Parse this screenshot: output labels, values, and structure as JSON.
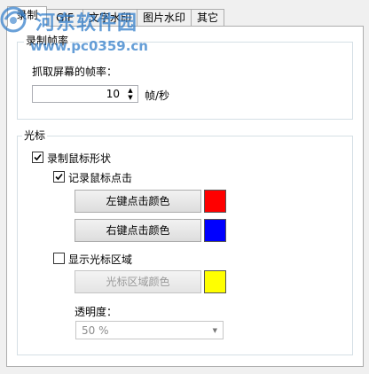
{
  "tabs": [
    {
      "label": "录制"
    },
    {
      "label": "GIF"
    },
    {
      "label": "文字水印"
    },
    {
      "label": "图片水印"
    },
    {
      "label": "其它"
    }
  ],
  "watermark": {
    "title": "河东软件园",
    "url": "www.pc0359.cn"
  },
  "recording_fps": {
    "group_label": "录制帧率",
    "field_label": "抓取屏幕的帧率：",
    "value": "10",
    "unit": "帧/秒"
  },
  "cursor": {
    "group_label": "光标",
    "record_shape": {
      "label": "录制鼠标形状",
      "checked": true
    },
    "record_clicks": {
      "label": "记录鼠标点击",
      "checked": true
    },
    "left_click_button": "左键点击颜色",
    "left_click_color": "#ff0000",
    "right_click_button": "右键点击颜色",
    "right_click_color": "#0000ff",
    "show_area": {
      "label": "显示光标区域",
      "checked": false
    },
    "area_color_button": "光标区域颜色",
    "area_color": "#ffff00",
    "opacity_label": "透明度：",
    "opacity_value": "50 %"
  }
}
